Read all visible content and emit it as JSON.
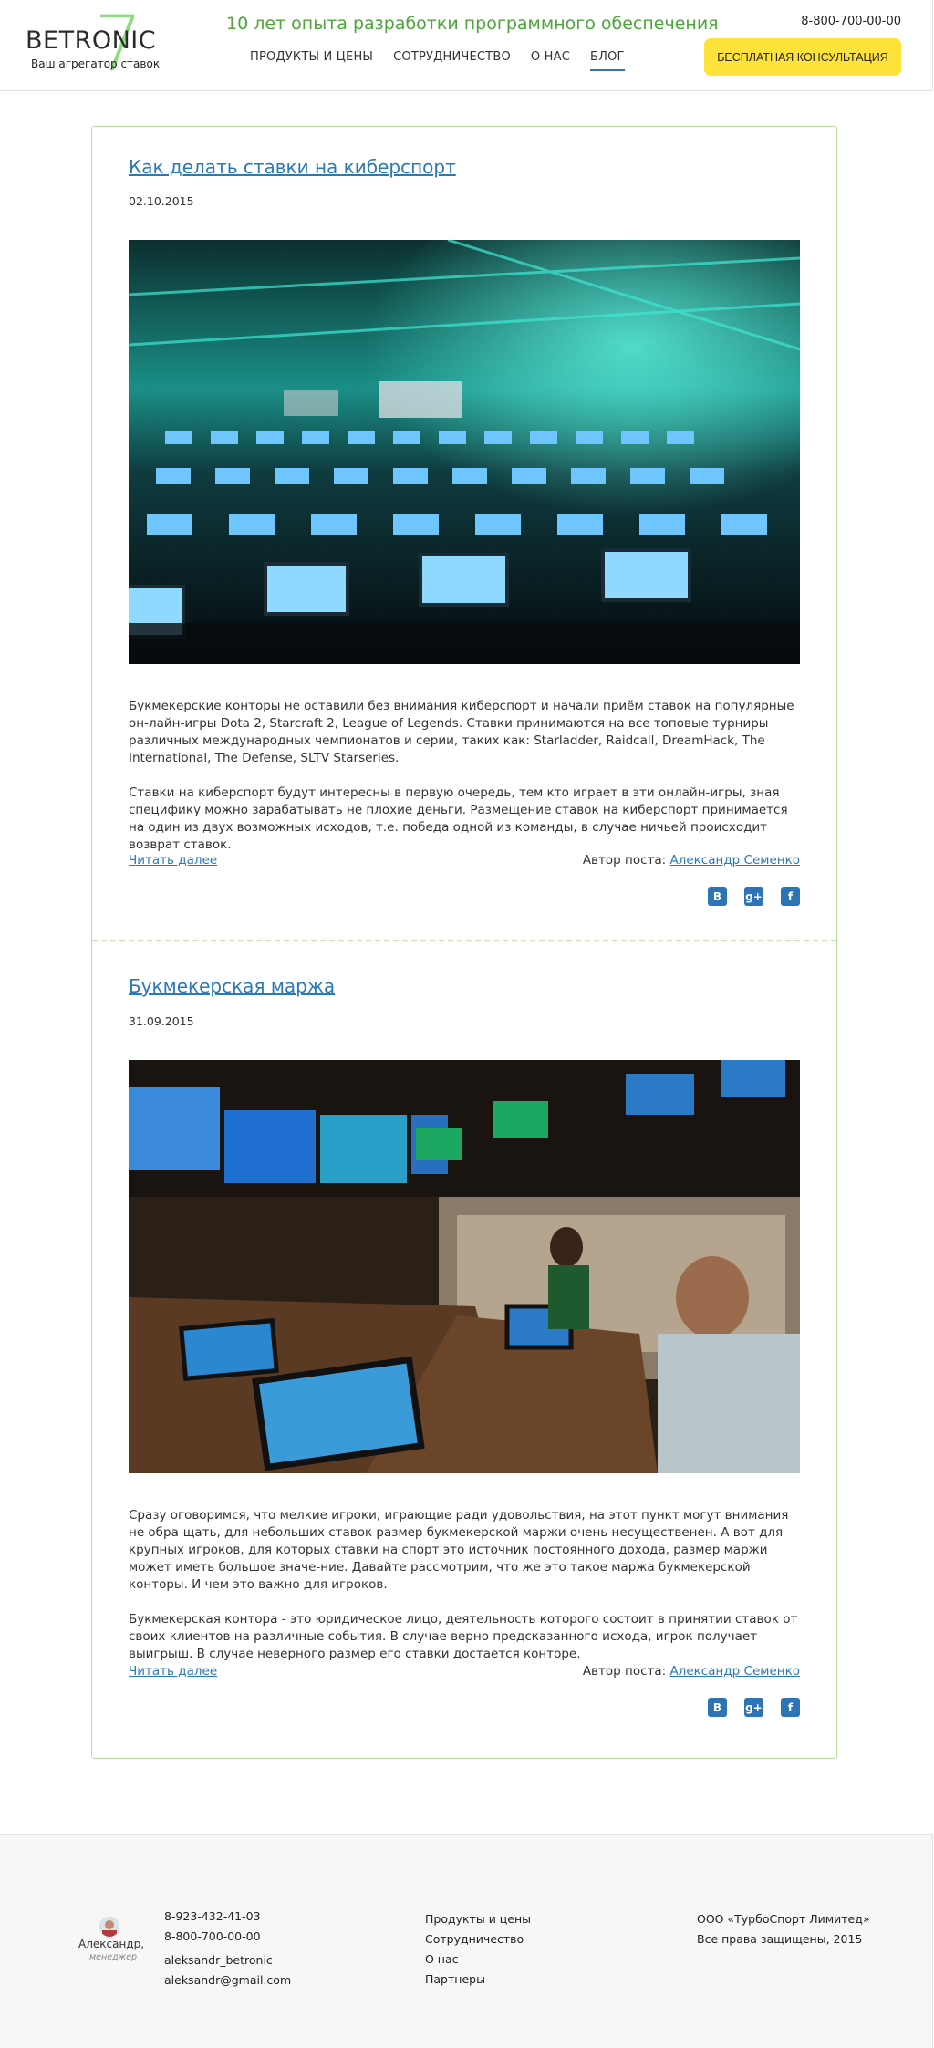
{
  "header": {
    "logo_name": "BETRONIC",
    "logo_seven": "7",
    "logo_tagline": "Ваш агрегатор ставок",
    "slogan": "10 лет опыта разработки программного обеспечения",
    "phone": "8-800-700-00-00",
    "cta_label": "БЕСПЛАТНАЯ КОНСУЛЬТАЦИЯ",
    "nav": [
      {
        "label": "ПРОДУКТЫ И ЦЕНЫ"
      },
      {
        "label": "СОТРУДНИЧЕСТВО"
      },
      {
        "label": "О НАС"
      },
      {
        "label": "БЛОГ",
        "active": true
      }
    ]
  },
  "posts": [
    {
      "title": "Как делать ставки на киберспорт",
      "date": "02.10.2015",
      "image_alt": "esports-arena-photo",
      "paragraphs": [
        "Букмекерские конторы не оставили без внимания киберспорт и начали приём ставок на популярные он-лайн-игры Dota 2, Starcraft 2, League of Legends. Ставки принимаются на все топовые турниры различных международных чемпионатов и серии, таких как: Starladder, Raidcall, DreamHack, The International, The Defense, SLTV Starseries.",
        "Ставки на киберспорт будут интересны в первую очередь, тем кто играет в эти онлайн-игры, зная специфику можно зарабатывать не плохие деньги. Размещение ставок на киберспорт принимается на один из двух возможных исходов, т.е. победа одной из команды, в случае ничьей происходит возврат ставок."
      ],
      "read_more": "Читать далее",
      "author_label": "Автор поста:",
      "author_name": "Александр Семенко"
    },
    {
      "title": "Букмекерская маржа",
      "date": "31.09.2015",
      "image_alt": "sportsbook-hall-photo",
      "paragraphs": [
        "Сразу оговоримся, что мелкие игроки, играющие ради удовольствия, на этот пункт могут внимания не обра-щать, для небольших ставок размер букмекерской маржи очень несущественен. А вот для крупных игроков, для которых ставки на спорт это источник постоянного дохода, размер маржи может иметь большое значе-ние. Давайте рассмотрим, что же это такое маржа букмекерской конторы. И чем это важно для игроков.",
        "Букмекерская контора - это юридическое лицо, деятельность которого состоит в принятии ставок от своих клиентов на различные события. В случае верно предсказанного исхода, игрок получает выигрыш. В случае неверного размер его ставки достается конторе."
      ],
      "read_more": "Читать далее",
      "author_label": "Автор поста:",
      "author_name": "Александр Семенко"
    }
  ],
  "share": {
    "vk": "B",
    "gplus": "g+",
    "fb": "f"
  },
  "footer": {
    "manager_name": "Александр,",
    "manager_role": "менеджер",
    "phone1": "8-923-432-41-03",
    "phone2": "8-800-700-00-00",
    "skype": "aleksandr_betronic",
    "email": "aleksandr@gmail.com",
    "links": [
      "Продукты и цены",
      "Сотрудничество",
      "О нас",
      "Партнеры"
    ],
    "company": "ООО «ТурбоСпорт Лимитед»",
    "rights": "Все права защищены, 2015"
  },
  "colors": {
    "accent": "#2a7ab8",
    "brand_green": "#4ca53a",
    "cta": "#ffe33a",
    "border_green": "#b6dd9a"
  }
}
